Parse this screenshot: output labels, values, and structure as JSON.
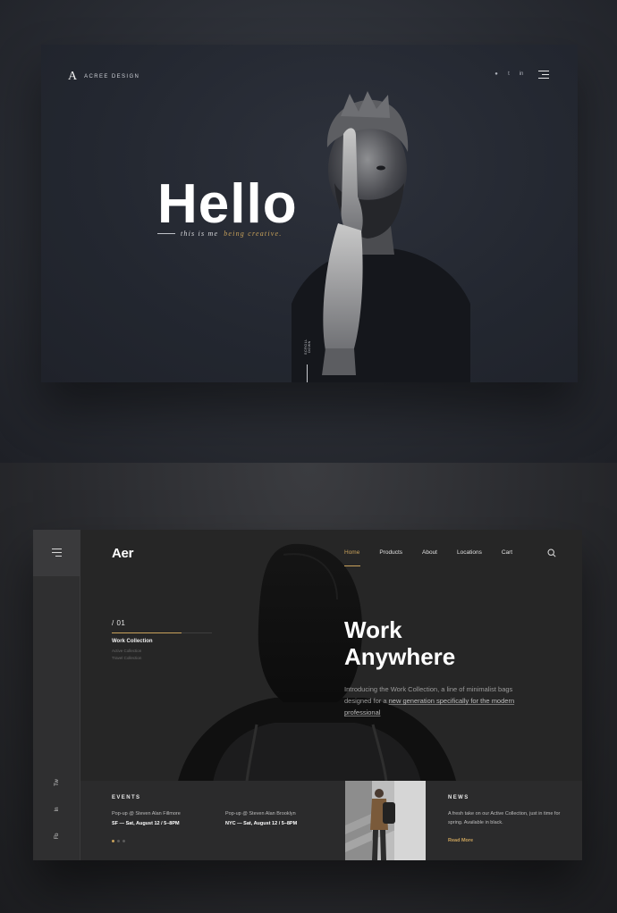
{
  "colors": {
    "accent": "#c9a25b",
    "top_card_bg": "#232730",
    "bottom_card_bg": "#262626"
  },
  "acree": {
    "logo_mark": "A",
    "logo_text": "ACREE DESIGN",
    "social": [
      "dribbble-icon",
      "twitter-icon",
      "linkedin-icon"
    ],
    "social_glyphs": [
      "●",
      "t",
      "in"
    ],
    "menu_icon": "menu-icon",
    "hello": "Hello",
    "tagline_lead": "this is me",
    "tagline_accent": "being creative.",
    "scroll_text": "SCROLL DOWN"
  },
  "aer": {
    "logo": "Aer",
    "menu_icon": "menu-icon",
    "nav": [
      "Home",
      "Products",
      "About",
      "Locations",
      "Cart"
    ],
    "nav_active": "Home",
    "search_icon": "search-icon",
    "index_num": "/ 01",
    "collections": [
      "Work Collection",
      "Active Collection",
      "Travel Collection"
    ],
    "headline_line1": "Work",
    "headline_line2": "Anywhere",
    "desc_plain": "Introducing the Work Collection, a line of minimalist bags designed for a ",
    "desc_link": "new generation specifically for the modern professional",
    "social_rail": [
      "Tw",
      "In",
      "Fb"
    ],
    "events_title": "EVENTS",
    "events": [
      {
        "name": "Pop-up @ Steven Alan Fillmore",
        "date": "SF — Sat, August 12 / 5–8PM"
      },
      {
        "name": "Pop-up @ Steven Alan Brooklyn",
        "date": "NYC — Sat, August 12 / 5–8PM"
      }
    ],
    "news_title": "NEWS",
    "news_text": "A fresh take on our Active Collection, just in time for spring. Available in black.",
    "news_more": "Read More"
  }
}
